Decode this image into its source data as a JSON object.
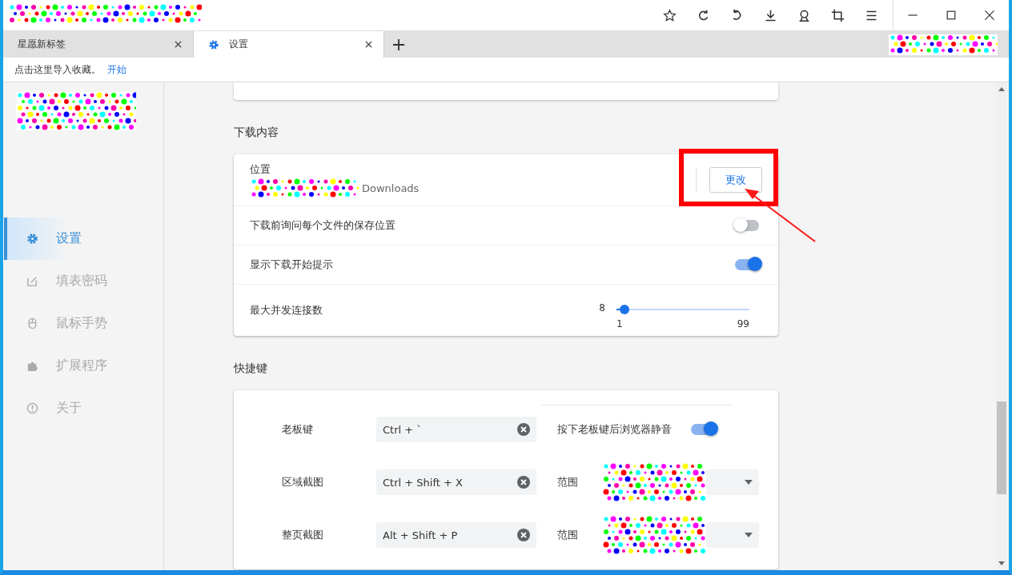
{
  "tabs": [
    {
      "label": "星愿新标签",
      "selected": false
    },
    {
      "label": "设置",
      "selected": true
    }
  ],
  "bookmark_bar": {
    "text": "点击这里导入收藏。",
    "link": "开始"
  },
  "sidebar": {
    "items": [
      {
        "label": "设置",
        "selected": true
      },
      {
        "label": "填表密码",
        "selected": false
      },
      {
        "label": "鼠标手势",
        "selected": false
      },
      {
        "label": "扩展程序",
        "selected": false
      },
      {
        "label": "关于",
        "selected": false
      }
    ]
  },
  "downloads": {
    "heading": "下载内容",
    "rows": [
      {
        "kind": "location",
        "label": "位置",
        "path": "Downloads",
        "button": "更改"
      },
      {
        "kind": "toggle",
        "label": "下载前询问每个文件的保存位置",
        "on": false
      },
      {
        "kind": "toggle",
        "label": "显示下载开始提示",
        "on": true
      },
      {
        "kind": "slider",
        "label": "最大并发连接数",
        "value": "8",
        "min": "1",
        "max": "99",
        "level": 0.06
      }
    ]
  },
  "shortcuts": {
    "heading": "快捷键",
    "rows": [
      {
        "kind": "toggle",
        "label": "老板键",
        "value": "Ctrl + `",
        "option": "按下老板键后浏览器静音",
        "on": true
      },
      {
        "kind": "select",
        "label": "区域截图",
        "value": "Ctrl + Shift + X",
        "option": "范围"
      },
      {
        "kind": "select",
        "label": "整页截图",
        "value": "Alt + Shift + P",
        "option": "范围"
      }
    ]
  }
}
